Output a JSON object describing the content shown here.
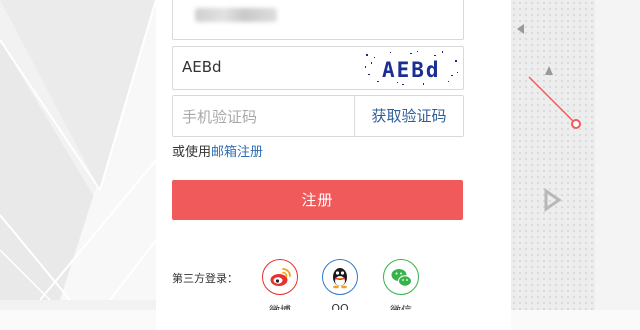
{
  "form": {
    "phone_value": "",
    "captcha_value": "AEBd",
    "captcha_image_text": "AEBd",
    "sms_placeholder": "手机验证码",
    "sms_button_label": "获取验证码",
    "alt_prefix": "或使用",
    "alt_link": "邮箱注册",
    "register_label": "注册"
  },
  "third_party": {
    "label": "第三方登录：",
    "providers": [
      {
        "name": "微博",
        "icon": "weibo-icon",
        "color": "#e9302c"
      },
      {
        "name": "QQ",
        "icon": "qq-icon",
        "color": "#2f79c8"
      },
      {
        "name": "微信",
        "icon": "wechat-icon",
        "color": "#36b34a"
      }
    ]
  },
  "colors": {
    "accent": "#f05a5a",
    "link": "#2f6db5",
    "deco_red": "#f05a5a"
  }
}
